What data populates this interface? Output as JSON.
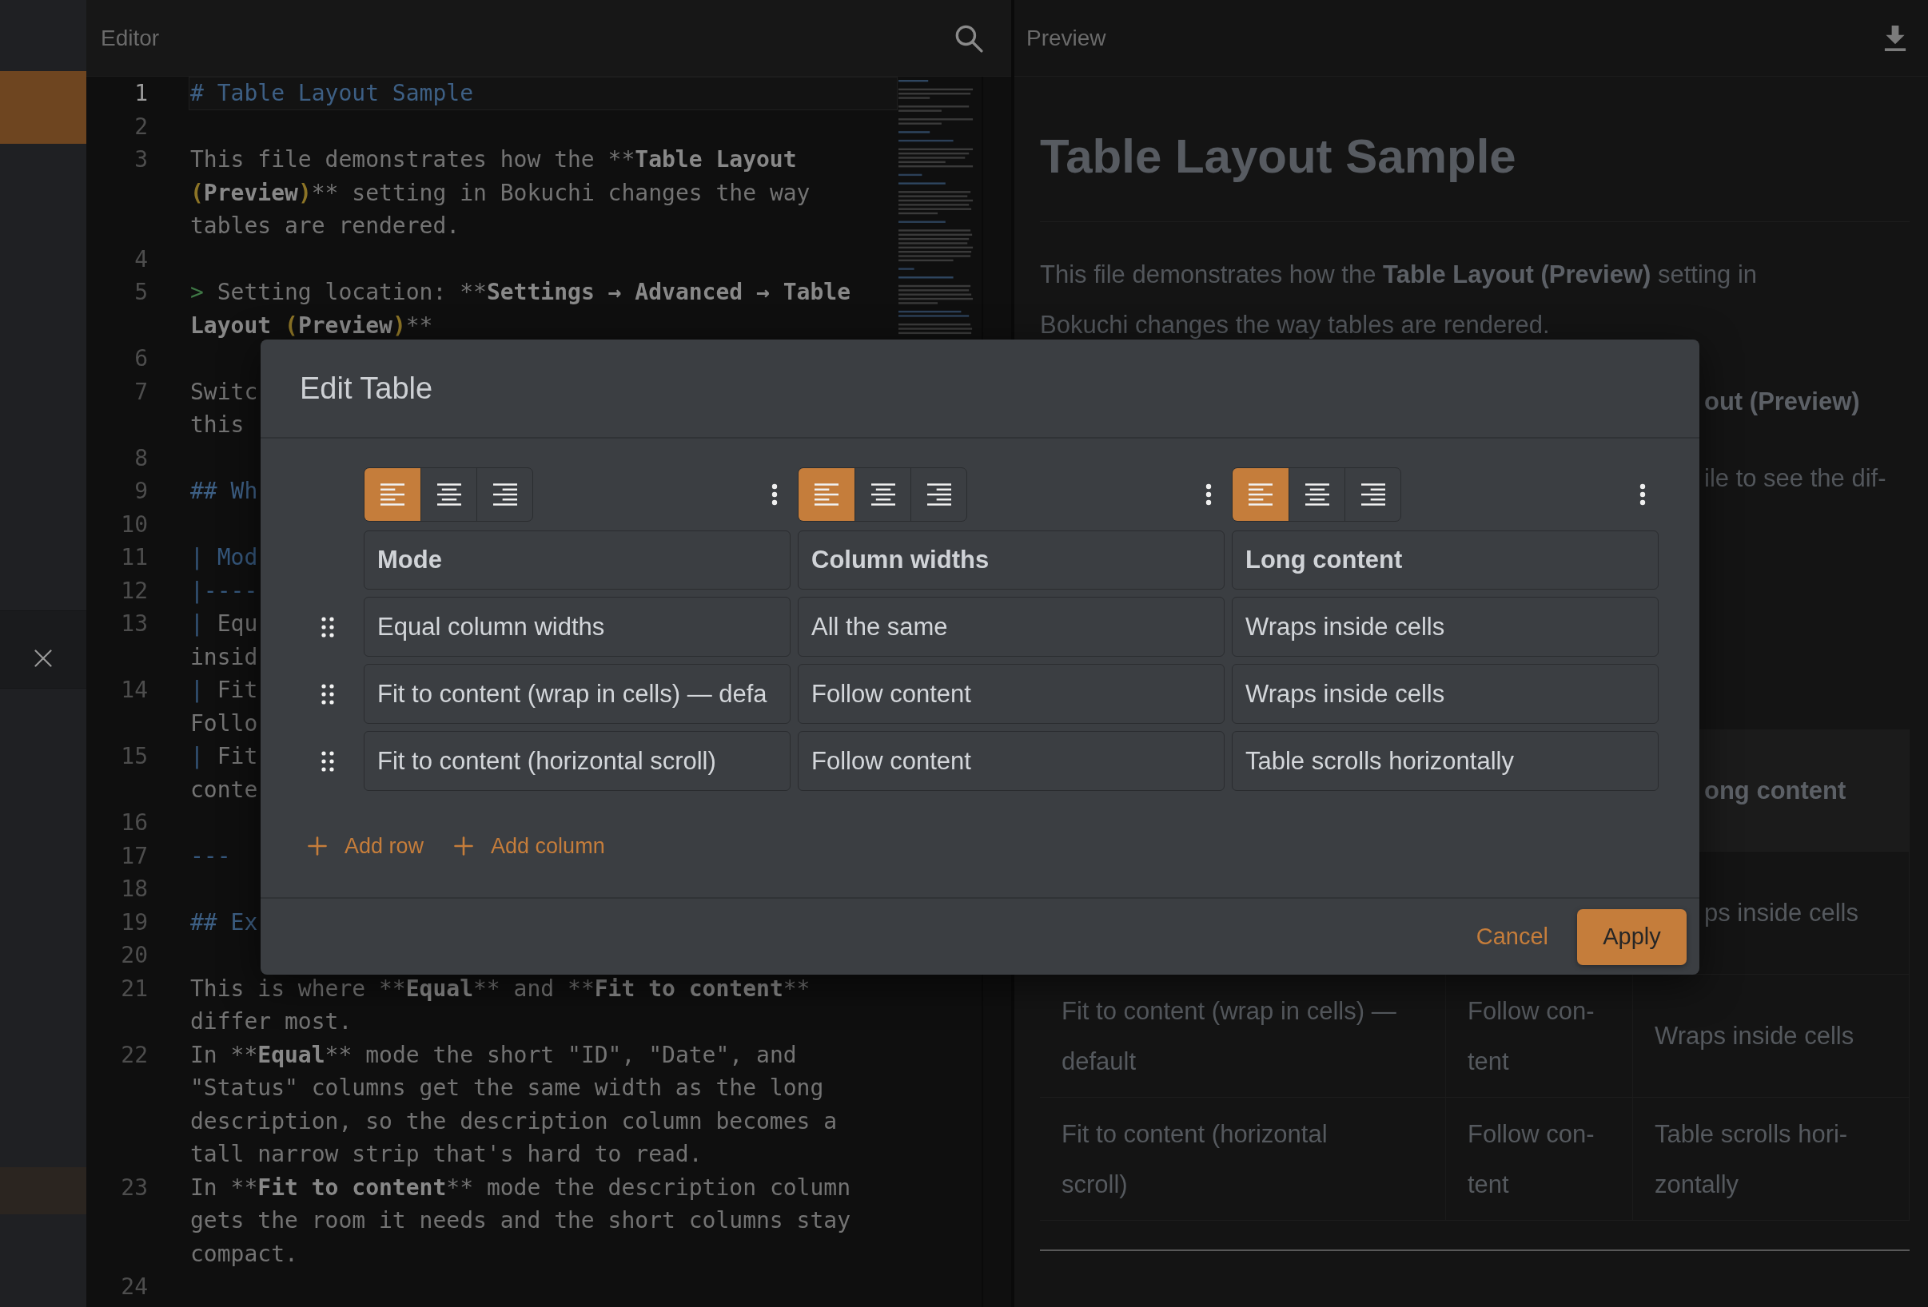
{
  "editor": {
    "title": "Editor",
    "lines": [
      {
        "number": "1",
        "current": true,
        "tokens": [
          {
            "kind": "heading",
            "text": "# Table Layout Sample"
          }
        ]
      },
      {
        "number": "2",
        "current": false
      },
      {
        "number": "3",
        "current": false,
        "tokens": [
          {
            "kind": "text",
            "text": "This file demonstrates how the **"
          },
          {
            "kind": "bold",
            "text": "Table Layout "
          },
          {
            "kind": "bracket",
            "text": "("
          },
          {
            "kind": "bold",
            "text": "Preview"
          },
          {
            "kind": "bracket",
            "text": ")"
          },
          {
            "kind": "text",
            "text": "** setting in Bokuchi changes the way tables are rendered."
          }
        ]
      },
      {
        "number": "4",
        "current": false
      },
      {
        "number": "5",
        "current": false,
        "tokens": [
          {
            "kind": "quote",
            "text": ">"
          },
          {
            "kind": "text",
            "text": " Setting location: **"
          },
          {
            "kind": "bold",
            "text": "Settings → Advanced → Table Layout "
          },
          {
            "kind": "bracket",
            "text": "("
          },
          {
            "kind": "bold",
            "text": "Preview"
          },
          {
            "kind": "bracket",
            "text": ")"
          },
          {
            "kind": "text",
            "text": "**"
          }
        ]
      },
      {
        "number": "6",
        "current": false
      },
      {
        "number": "7",
        "current": false,
        "tokens": [
          {
            "kind": "text",
            "text": "Switc\nthis"
          }
        ]
      },
      {
        "number": "8",
        "current": false
      },
      {
        "number": "9",
        "current": false,
        "tokens": [
          {
            "kind": "heading",
            "text": "## Wh"
          }
        ]
      },
      {
        "number": "10",
        "current": false
      },
      {
        "number": "11",
        "current": false,
        "tokens": [
          {
            "kind": "marker",
            "text": "| Mod"
          }
        ]
      },
      {
        "number": "12",
        "current": false,
        "tokens": [
          {
            "kind": "marker",
            "text": "|----"
          }
        ]
      },
      {
        "number": "13",
        "current": false,
        "tokens": [
          {
            "kind": "marker",
            "text": "|"
          },
          {
            "kind": "text",
            "text": " Equ\ninsid"
          }
        ]
      },
      {
        "number": "14",
        "current": false,
        "tokens": [
          {
            "kind": "marker",
            "text": "|"
          },
          {
            "kind": "text",
            "text": " Fit\nFollo"
          }
        ]
      },
      {
        "number": "15",
        "current": false,
        "tokens": [
          {
            "kind": "marker",
            "text": "|"
          },
          {
            "kind": "text",
            "text": " Fit\nconte"
          }
        ]
      },
      {
        "number": "16",
        "current": false
      },
      {
        "number": "17",
        "current": false,
        "tokens": [
          {
            "kind": "marker",
            "text": "---"
          }
        ]
      },
      {
        "number": "18",
        "current": false
      },
      {
        "number": "19",
        "current": false,
        "tokens": [
          {
            "kind": "heading",
            "text": "## Ex"
          }
        ]
      },
      {
        "number": "20",
        "current": false
      },
      {
        "number": "21",
        "current": false,
        "tokens": [
          {
            "kind": "text",
            "text": "This is where **"
          },
          {
            "kind": "bold",
            "text": "Equal"
          },
          {
            "kind": "text",
            "text": "** and **"
          },
          {
            "kind": "bold",
            "text": "Fit to content"
          },
          {
            "kind": "text",
            "text": "** differ most."
          }
        ]
      },
      {
        "number": "22",
        "current": false,
        "tokens": [
          {
            "kind": "text",
            "text": "In **"
          },
          {
            "kind": "bold",
            "text": "Equal"
          },
          {
            "kind": "text",
            "text": "** mode the short \"ID\", \"Date\", and \"Status\" columns get the same width as the long description, so the description column becomes a tall narrow strip that's hard to read."
          }
        ]
      },
      {
        "number": "23",
        "current": false,
        "tokens": [
          {
            "kind": "text",
            "text": "In **"
          },
          {
            "kind": "bold",
            "text": "Fit to content"
          },
          {
            "kind": "text",
            "text": "** mode the description column gets the room it needs and the short columns stay compact."
          }
        ]
      },
      {
        "number": "24",
        "current": false
      }
    ]
  },
  "preview": {
    "title": "Preview",
    "heading": "Table Layout Sample",
    "paragraph": "This file demonstrates how the **Table Layout (Preview)** setting in Bokuchi changes the way tables are rendered.",
    "partial_texts": [
      {
        "kind": "bold",
        "text": "out (Preview)"
      },
      {
        "kind": "plain",
        "text": "ile to see the dif-"
      }
    ],
    "table": {
      "rows": [
        {
          "kind": "header",
          "cells": [
            "ong content"
          ]
        },
        {
          "kind": "body",
          "cells": [
            "ps inside cells"
          ]
        },
        {
          "kind": "body",
          "cells": [
            "Fit to content (wrap in cells) —\ndefault",
            "Follow con-\ntent",
            "Wraps inside cells"
          ]
        },
        {
          "kind": "body",
          "cells": [
            "Fit to content (horizontal\nscroll)",
            "Follow con-\ntent",
            "Table scrolls hori-\nzontally"
          ]
        }
      ]
    }
  },
  "dialog": {
    "title": "Edit Table",
    "columns": [
      {
        "header": "Mode",
        "alignments": [
          {
            "kind": "left",
            "selected": true
          },
          {
            "kind": "center",
            "selected": false
          },
          {
            "kind": "right",
            "selected": false
          }
        ]
      },
      {
        "header": "Column widths",
        "alignments": [
          {
            "kind": "left",
            "selected": true
          },
          {
            "kind": "center",
            "selected": false
          },
          {
            "kind": "right",
            "selected": false
          }
        ]
      },
      {
        "header": "Long content",
        "alignments": [
          {
            "kind": "left",
            "selected": true
          },
          {
            "kind": "center",
            "selected": false
          },
          {
            "kind": "right",
            "selected": false
          }
        ]
      }
    ],
    "rows": [
      {
        "cells": [
          "Equal column widths",
          "All the same",
          "Wraps inside cells"
        ]
      },
      {
        "cells": [
          "Fit to content (wrap in cells) — defa",
          "Follow content",
          "Wraps inside cells"
        ]
      },
      {
        "cells": [
          "Fit to content (horizontal scroll)",
          "Follow content",
          "Table scrolls horizontally"
        ]
      }
    ],
    "actions": [
      {
        "label": "Add row"
      },
      {
        "label": "Add column"
      }
    ],
    "buttons": [
      {
        "kind": "cancel",
        "label": "Cancel"
      },
      {
        "kind": "apply",
        "label": "Apply"
      }
    ]
  }
}
